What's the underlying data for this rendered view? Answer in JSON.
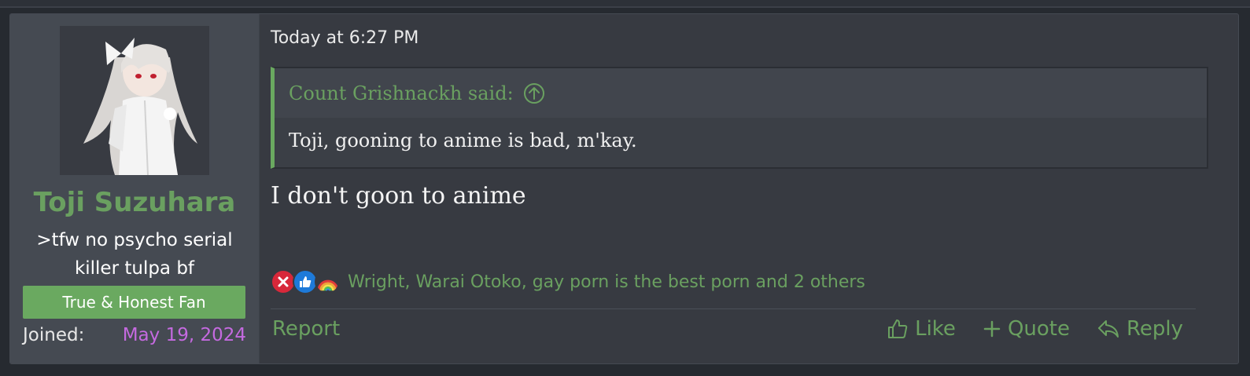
{
  "post": {
    "timestamp": "Today at 6:27 PM",
    "message": "I don't goon to anime"
  },
  "user": {
    "name": "Toji Suzuhara",
    "title": ">tfw no psycho serial killer tulpa bf",
    "banner": "True & Honest Fan",
    "joined_label": "Joined:",
    "joined_date": "May 19, 2024",
    "avatar_alt": "avatar"
  },
  "quote": {
    "author": "Count Grishnackh said:",
    "text": "Toji, gooning to anime is bad, m'kay."
  },
  "reactions": {
    "icons": [
      "dumb-x-icon",
      "like-icon",
      "rainbow-icon"
    ],
    "names": "Wright, Warai Otoko, gay porn is the best porn and 2 others"
  },
  "actions": {
    "report": "Report",
    "like": "Like",
    "quote": "Quote",
    "reply": "Reply"
  },
  "colors": {
    "accent_green": "#6aa060",
    "date_purple": "#c56ae0",
    "banner_green": "#6aa960"
  }
}
